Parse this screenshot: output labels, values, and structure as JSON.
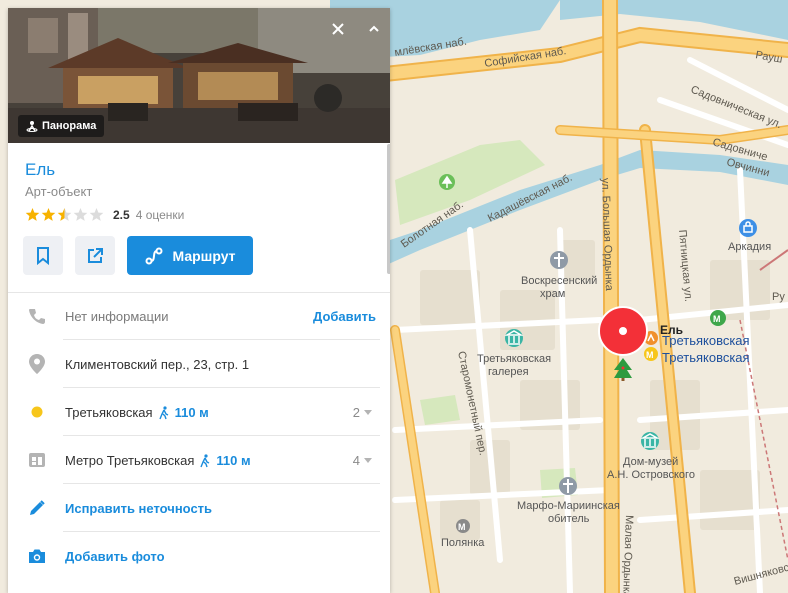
{
  "colors": {
    "accent": "#1a8cdc",
    "pin": "#f33038",
    "star": "#f7b200",
    "water": "#aad3df",
    "road": "#f9c25a"
  },
  "panel": {
    "panorama_label": "Панорама",
    "close_icon": "close-icon",
    "collapse_icon": "chevron-up-icon",
    "title": "Ель",
    "subtitle": "Арт-объект",
    "rating": {
      "value": "2.5",
      "count": "4 оценки",
      "stars_filled": 2.5,
      "stars_total": 5
    },
    "actions": {
      "bookmark_icon": "bookmark-icon",
      "share_icon": "share-icon",
      "route_label": "Маршрут"
    },
    "phone": {
      "text": "Нет информации",
      "action": "Добавить"
    },
    "address": {
      "text": "Климентовский пер., 23, стр. 1"
    },
    "metro": [
      {
        "name": "Третьяковская",
        "walk": "110 м",
        "count": "2"
      },
      {
        "name": "Метро Третьяковская",
        "walk": "110 м",
        "count": "4"
      }
    ],
    "fix_label": "Исправить неточность",
    "photo_label": "Добавить фото"
  },
  "map": {
    "place_label": "Ель",
    "metro_label_1": "Третьяковская",
    "metro_label_2": "Третьяковская",
    "streets": {
      "kremlin_emb": "млёвская наб.",
      "sofia_emb": "Софийская наб.",
      "raush": "Рауш",
      "sadovnicheskaya": "Садовническая ул.",
      "sadovnicheskaya2": "Садовниче",
      "ovchinnikovskaya": "Овчинни",
      "bolotnaya": "Болотная наб.",
      "kadashevskaya": "Кадашёвская наб.",
      "b_ordynka": "ул. Большая Ордынка",
      "pyatnitskaya": "Пятницкая ул.",
      "staromonetny": "Старомонетный пер.",
      "m_ordynka": "Малая Ордынка",
      "vishnyakovsky": "Вишняковский",
      "ru": "Ру"
    },
    "pois": {
      "arcadia": "Аркадия",
      "voskresensky_1": "Воскресенский",
      "voskresensky_2": "храм",
      "gallery_1": "Третьяковская",
      "gallery_2": "галерея",
      "ostrovsky_1": "Дом-музей",
      "ostrovsky_2": "А.Н. Островского",
      "marfo_1": "Марфо-Мариинская",
      "marfo_2": "обитель",
      "polyanka": "Полянка"
    }
  }
}
